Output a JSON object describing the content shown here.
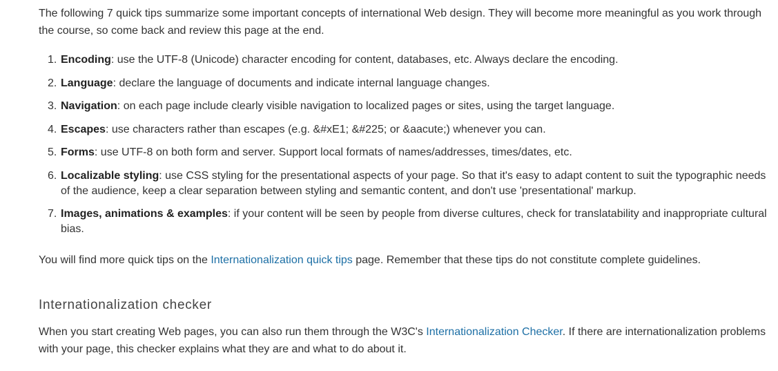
{
  "intro": "The following 7 quick tips summarize some important concepts of international Web design. They will become more meaningful as you work through the course, so come back and review this page at the end.",
  "tips": [
    {
      "num": "1.",
      "term": "Encoding",
      "text": ": use the UTF-8 (Unicode) character encoding for content, databases, etc. Always declare the encoding."
    },
    {
      "num": "2.",
      "term": "Language",
      "text": ": declare the language of documents and indicate internal language changes."
    },
    {
      "num": "3.",
      "term": "Navigation",
      "text": ": on each page include clearly visible navigation to localized pages or sites, using the target language."
    },
    {
      "num": "4.",
      "term": "Escapes",
      "text": ": use characters rather than escapes (e.g. &#xE1; &#225; or &aacute;) whenever you can."
    },
    {
      "num": "5.",
      "term": "Forms",
      "text": ": use UTF-8 on both form and server. Support local formats of names/addresses, times/dates, etc."
    },
    {
      "num": "6.",
      "term": "Localizable styling",
      "text": ": use CSS styling for the presentational aspects of your page. So that it's easy to adapt content to suit the typographic needs of the audience, keep a clear separation between styling and semantic content, and don't use 'presentational' markup."
    },
    {
      "num": "7.",
      "term": "Images, animations & examples",
      "text": ": if your content will be seen by people from diverse cultures, check for translatability and inappropriate cultural bias."
    }
  ],
  "more": {
    "before": "You will find more quick tips on the ",
    "link": "Internationalization quick tips",
    "after": " page. Remember that these tips do not constitute complete guidelines."
  },
  "checker": {
    "heading": "Internationalization checker",
    "before": "When you start creating Web pages, you can also run them through the W3C's ",
    "link": "Internationalization Checker",
    "after": ".  If there are internationalization problems with your page, this checker explains what they are and what to do about it."
  },
  "colors": {
    "text": "#333333",
    "link": "#1d6fa5",
    "heading": "#444444"
  }
}
